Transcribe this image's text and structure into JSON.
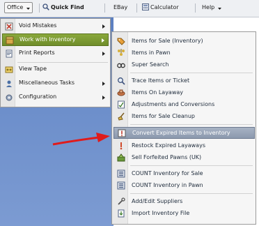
{
  "toolbar": {
    "office_label": "Office",
    "quick_find_label": "Quick Find",
    "ebay_label": "EBay",
    "calculator_label": "Calculator",
    "help_label": "Help"
  },
  "office_menu": {
    "items": [
      {
        "label": "Void Mistakes",
        "icon": "void-icon",
        "has_submenu": true
      },
      {
        "label": "Work with Inventory",
        "icon": "inventory-icon",
        "has_submenu": true
      },
      {
        "label": "Print Reports",
        "icon": "reports-icon",
        "has_submenu": true
      },
      {
        "label": "View Tape",
        "icon": "tape-icon",
        "has_submenu": false
      },
      {
        "label": "Miscellaneous Tasks",
        "icon": "tasks-icon",
        "has_submenu": true
      },
      {
        "label": "Configuration",
        "icon": "configuration-icon",
        "has_submenu": true
      }
    ]
  },
  "inventory_submenu": {
    "items": [
      {
        "label": "Items for Sale (Inventory)"
      },
      {
        "label": "Items in Pawn"
      },
      {
        "label": "Super Search"
      },
      {
        "label": "Trace Items or Ticket"
      },
      {
        "label": "Items On Layaway"
      },
      {
        "label": "Adjustments and Conversions"
      },
      {
        "label": "Items for Sale Cleanup"
      },
      {
        "label": "Convert Expired Items to Inventory"
      },
      {
        "label": "Restock Expired Layaways"
      },
      {
        "label": "Sell Forfeited Pawns (UK)"
      },
      {
        "label": "COUNT Inventory for Sale"
      },
      {
        "label": "COUNT Inventory in Pawn"
      },
      {
        "label": "Add/Edit Suppliers"
      },
      {
        "label": "Import Inventory File"
      }
    ]
  },
  "colors": {
    "active_menu_item": "#7a9832",
    "highlighted_submenu_item": "#98a4b8",
    "annotation_arrow": "#e01b1b",
    "desktop_background": "#6a8cca"
  }
}
